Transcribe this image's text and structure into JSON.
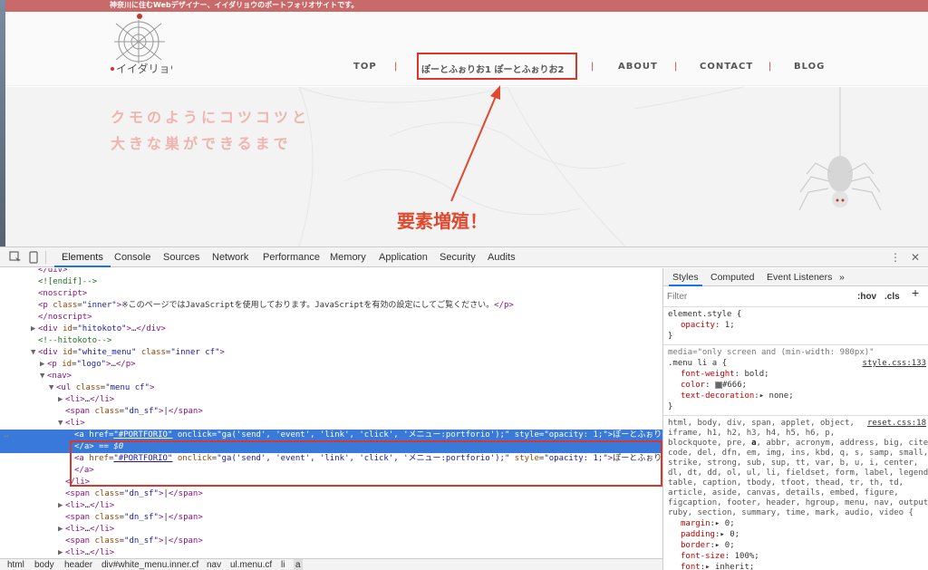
{
  "site": {
    "topbar_text": "神奈川に住むWebデザイナー、イイダリョウのポートフォリオサイトです。",
    "logo_text": "イイダリョウ",
    "nav": [
      {
        "label": "TOP"
      },
      {
        "label": "ぽーとふぉりお1 ぽーとふぉりお2"
      },
      {
        "label": "ABOUT"
      },
      {
        "label": "CONTACT"
      },
      {
        "label": "BLOG"
      }
    ],
    "nav_separator": "|",
    "catch_line1": "クモのようにコツコツと",
    "catch_line2": "大きな巣ができるまで",
    "annotation": "要素増殖！"
  },
  "devtools": {
    "tabs": [
      "Elements",
      "Console",
      "Sources",
      "Network",
      "Performance",
      "Memory",
      "Application",
      "Security",
      "Audits"
    ],
    "active_tab": "Elements",
    "menu_icon": "⋮",
    "close_icon": "✕",
    "breadcrumb": [
      "html",
      "body",
      "header",
      "div#white_menu.inner.cf",
      "nav",
      "ul.menu.cf",
      "li",
      "a"
    ],
    "styles_tabs": [
      "Styles",
      "Computed",
      "Event Listeners",
      "»"
    ],
    "filter_placeholder": "Filter",
    "hov_label": ":hov",
    "cls_label": ".cls",
    "plus_label": "+"
  },
  "colors": {
    "accent_red": "#d9372b",
    "topbar": "#c96a6a",
    "selection_blue": "#3879d9"
  }
}
